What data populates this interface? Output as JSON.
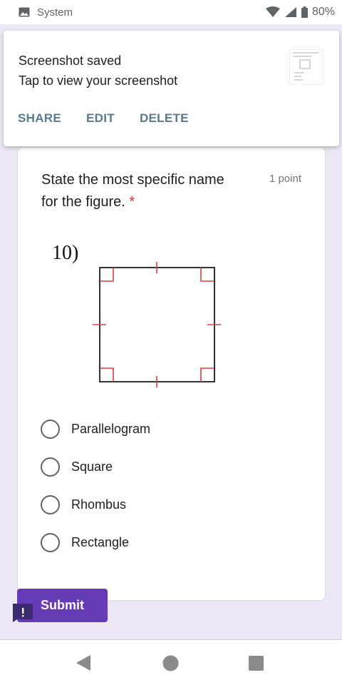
{
  "status_bar": {
    "app_label": "System",
    "battery": "80%",
    "icons": [
      "image-icon",
      "wifi-icon",
      "signal-icon",
      "battery-icon"
    ]
  },
  "notification": {
    "title": "Screenshot saved",
    "text": "Tap to view your screenshot",
    "actions": [
      "SHARE",
      "EDIT",
      "DELETE"
    ]
  },
  "question": {
    "title": "State the most specific name for the figure.",
    "required_mark": "*",
    "points": "1 point",
    "figure_label": "10)",
    "options": [
      "Parallelogram",
      "Square",
      "Rhombus",
      "Rectangle"
    ]
  },
  "form": {
    "submit_label": "Submit"
  },
  "colors": {
    "accent": "#673ab7",
    "page_bg": "#ece7f5",
    "required": "#d93025",
    "figure_marks": "#e23a3a",
    "action_text": "#5a7a8c"
  },
  "nav": [
    "back-icon",
    "home-icon",
    "recents-icon"
  ]
}
